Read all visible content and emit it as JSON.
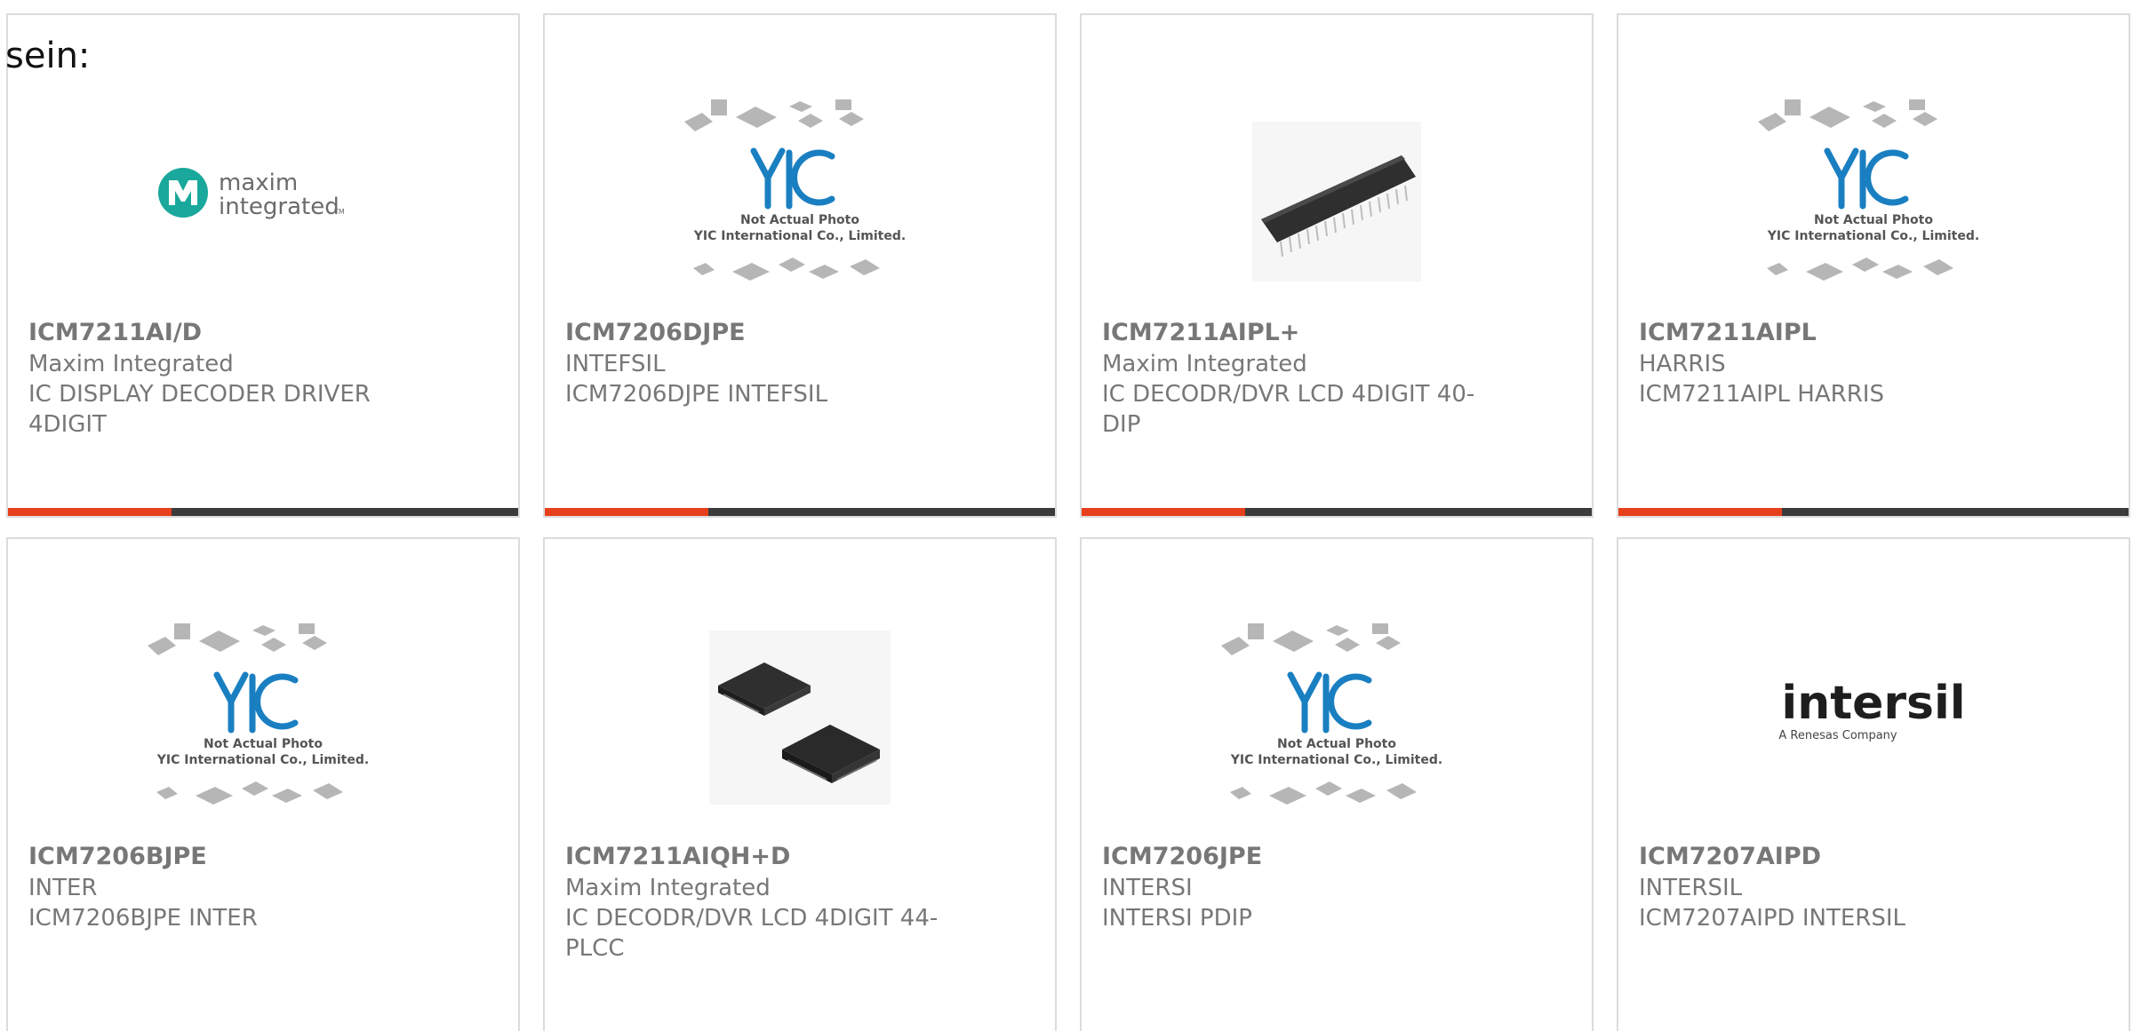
{
  "intro_text": "sein:",
  "yic_text": {
    "line1": "Not Actual Photo",
    "line2": "YIC International Co., Limited."
  },
  "brand_logos": {
    "maxim_line1": "maxim",
    "maxim_line2": "integrated",
    "maxim_tm": "TM",
    "intersil_word": "intersil",
    "intersil_sub": "A Renesas Company"
  },
  "colors": {
    "accent": "#e8401c",
    "bar": "#3b3b3b",
    "text": "#777777",
    "border": "#dcdcdc",
    "yic_blue": "#1a7fc1",
    "maxim_teal": "#19a89b"
  },
  "products": [
    {
      "part": "ICM7211AI/D",
      "manufacturer": "Maxim Integrated",
      "description": "IC DISPLAY DECODER DRIVER 4DIGIT",
      "image": "maxim-logo"
    },
    {
      "part": "ICM7206DJPE",
      "manufacturer": "INTEFSIL",
      "description": "ICM7206DJPE INTEFSIL",
      "image": "yic-placeholder"
    },
    {
      "part": "ICM7211AIPL+",
      "manufacturer": "Maxim Integrated",
      "description": "IC DECODR/DVR LCD 4DIGIT 40-DIP",
      "image": "dip-chip-photo"
    },
    {
      "part": "ICM7211AIPL",
      "manufacturer": "HARRIS",
      "description": "ICM7211AIPL HARRIS",
      "image": "yic-placeholder"
    },
    {
      "part": "ICM7206BJPE",
      "manufacturer": "INTER",
      "description": "ICM7206BJPE INTER",
      "image": "yic-placeholder"
    },
    {
      "part": "ICM7211AIQH+D",
      "manufacturer": "Maxim Integrated",
      "description": "IC DECODR/DVR LCD 4DIGIT 44-PLCC",
      "image": "plcc-chip-photo"
    },
    {
      "part": "ICM7206JPE",
      "manufacturer": "INTERSI",
      "description": "INTERSI PDIP",
      "image": "yic-placeholder"
    },
    {
      "part": "ICM7207AIPD",
      "manufacturer": "INTERSIL",
      "description": "ICM7207AIPD INTERSIL",
      "image": "intersil-logo"
    }
  ]
}
